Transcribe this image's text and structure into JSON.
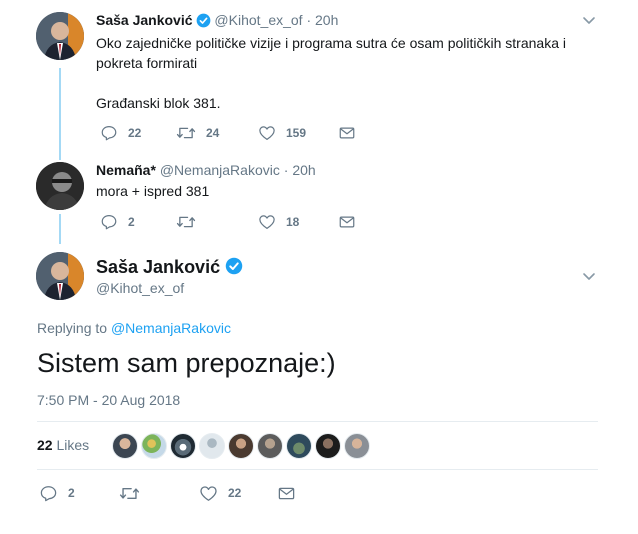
{
  "tweet1": {
    "name": "Saša Janković",
    "handle": "@Kihot_ex_of",
    "separator": "·",
    "time": "20h",
    "text_line1": "Oko zajedničke političke vizije i programa sutra će osam političkih stranaka i",
    "text_line2": "pokreta formirati",
    "text_line3": "Građanski blok 381.",
    "replies": "22",
    "retweets": "24",
    "likes": "159"
  },
  "tweet2": {
    "name": "Nemaña*",
    "handle": "@NemanjaRakovic",
    "separator": "·",
    "time": "20h",
    "text": "mora + ispred 381",
    "replies": "2",
    "retweets": "",
    "likes": "18"
  },
  "main_tweet": {
    "name": "Saša Janković",
    "handle": "@Kihot_ex_of",
    "replying_label": "Replying to",
    "replying_mention": "@NemanjaRakovic",
    "text": "Sistem sam prepoznaje:)",
    "timestamp": "7:50 PM - 20 Aug 2018",
    "likes_count": "22",
    "likes_label": "Likes",
    "replies": "2",
    "retweets": "",
    "likes": "22"
  },
  "colors": {
    "verified": "#1da1f2",
    "thread_line": "#a4d9f5",
    "secondary_text": "#657786",
    "separator": "#e6ecf0"
  },
  "icons": {
    "reply": "reply-icon",
    "retweet": "retweet-icon",
    "like": "heart-icon",
    "message": "envelope-icon",
    "caret": "chevron-down-icon",
    "verified": "verified-badge-icon"
  }
}
